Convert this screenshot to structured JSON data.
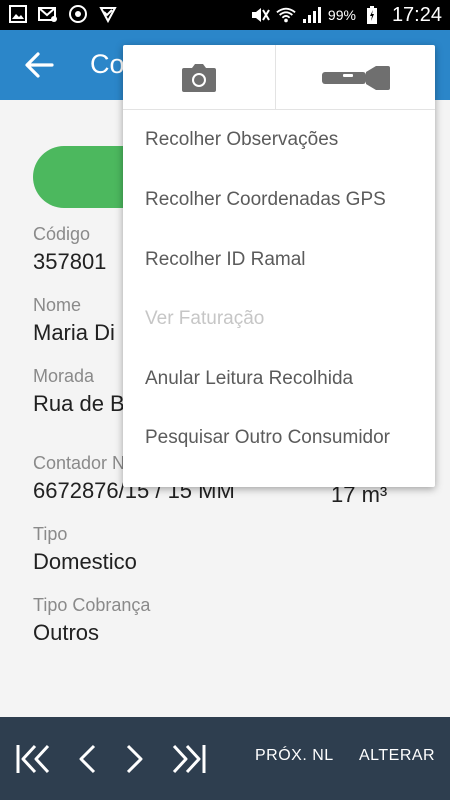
{
  "status_bar": {
    "battery_percent": "99%",
    "time": "17:24"
  },
  "app_bar": {
    "title": "Co"
  },
  "details": {
    "codigo": {
      "label": "Código",
      "value": "357801"
    },
    "nome": {
      "label": "Nome",
      "value": "Maria Di"
    },
    "morada": {
      "label": "Morada",
      "value": "Rua de B"
    },
    "contador": {
      "label": "Contador N",
      "value": "6672876/15 / 15 MM"
    },
    "consumo": {
      "value": "17 m³"
    },
    "tipo": {
      "label": "Tipo",
      "value": "Domestico"
    },
    "tipo_cobranca": {
      "label": "Tipo Cobrança",
      "value": "Outros"
    }
  },
  "menu": {
    "icons": [
      "camera-icon",
      "flashlight-icon"
    ],
    "items": [
      {
        "label": "Recolher Observações",
        "enabled": true
      },
      {
        "label": "Recolher Coordenadas GPS",
        "enabled": true
      },
      {
        "label": "Recolher ID Ramal",
        "enabled": true
      },
      {
        "label": "Ver Faturação",
        "enabled": false
      },
      {
        "label": "Anular Leitura Recolhida",
        "enabled": true
      },
      {
        "label": "Pesquisar Outro Consumidor",
        "enabled": true
      }
    ]
  },
  "bottom_bar": {
    "next_nl": "PRÓX. NL",
    "alterar": "ALTERAR"
  },
  "colors": {
    "app_bar": "#2b86c9",
    "green_button": "#4cb85e",
    "bottom_bar": "#2e3e4f",
    "menu_text": "#5b5b5b",
    "menu_text_disabled": "#c6c6c6"
  }
}
